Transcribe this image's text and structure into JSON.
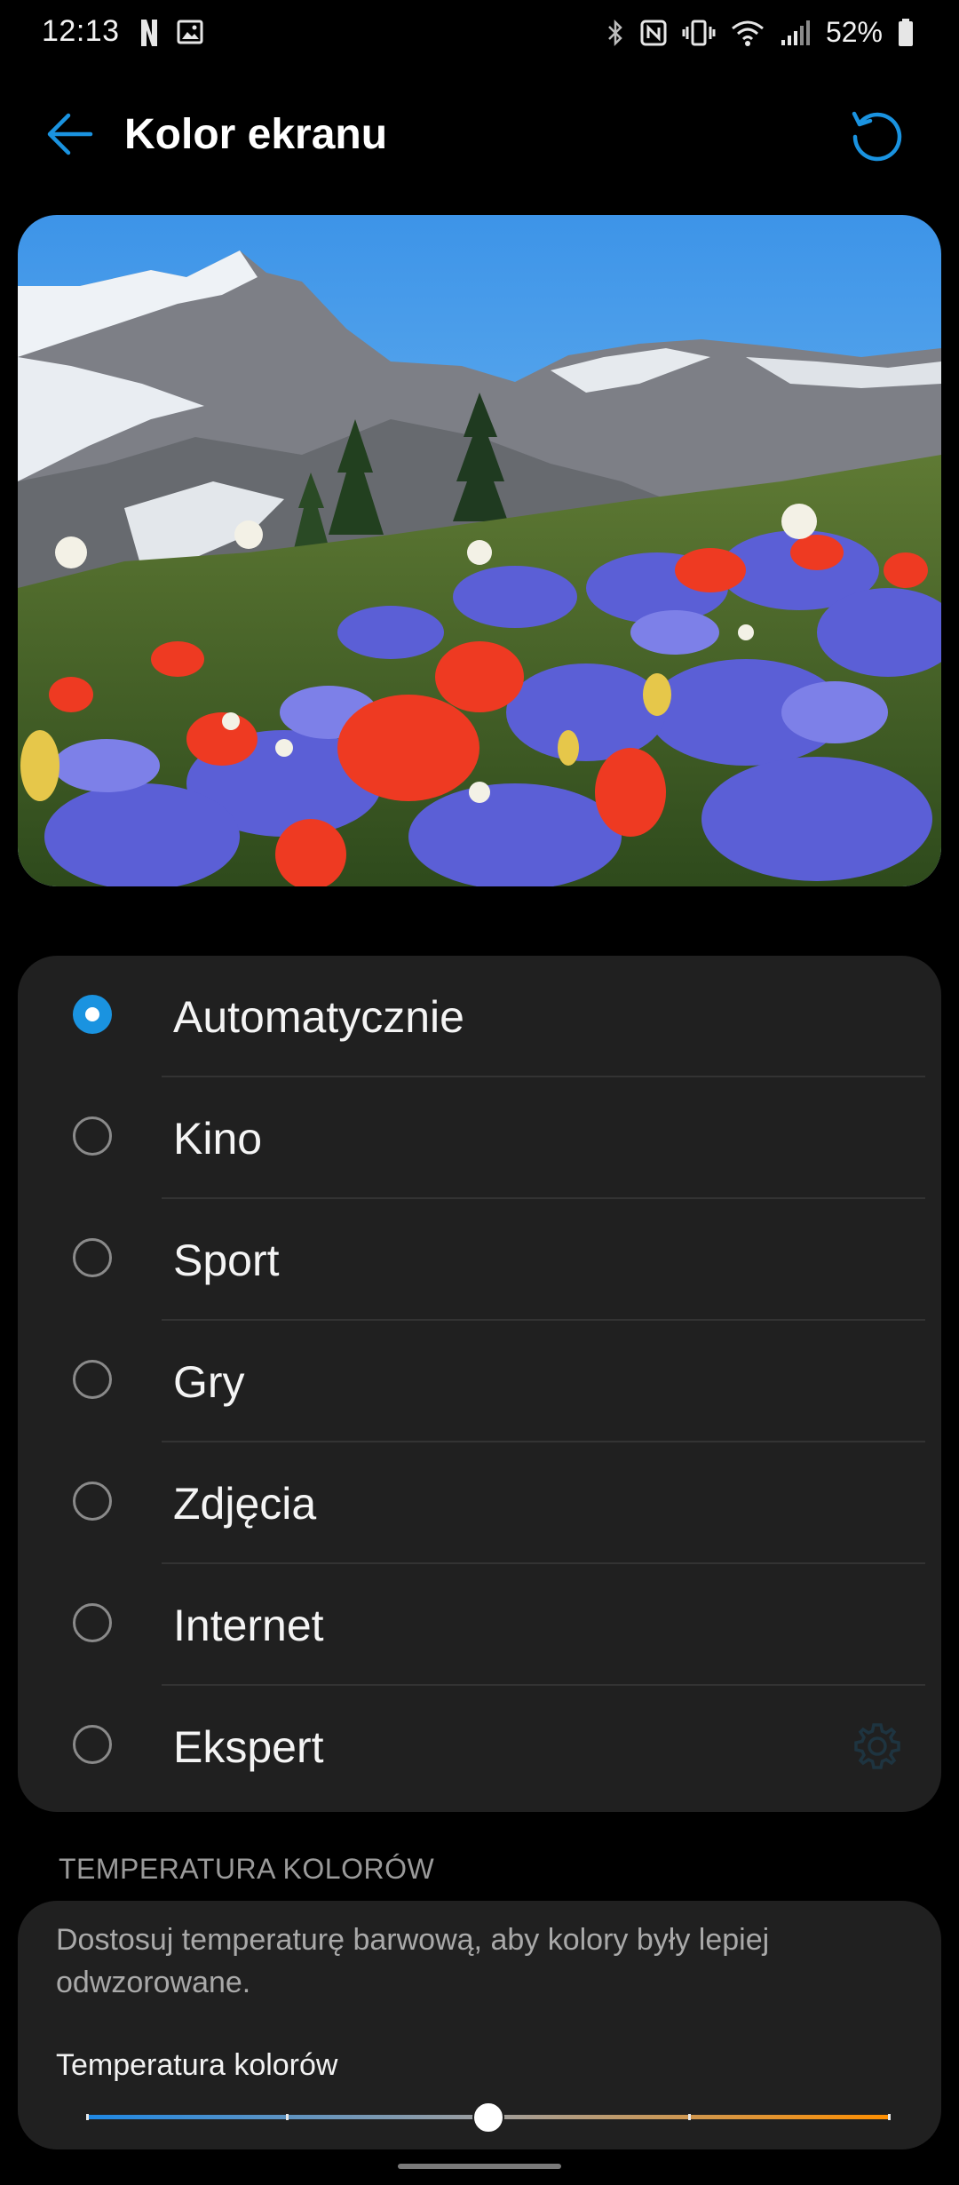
{
  "status_bar": {
    "time": "12:13",
    "left_icons": [
      "netflix-icon",
      "image-icon"
    ],
    "right_icons": [
      "bluetooth-icon",
      "nfc-icon",
      "vibrate-icon",
      "wifi-icon",
      "signal-icon",
      "battery-icon"
    ],
    "battery_percent": "52%"
  },
  "app_bar": {
    "title": "Kolor ekranu",
    "back_icon": "arrow-left-icon",
    "reset_icon": "refresh-icon",
    "accent_color": "#1a93e0"
  },
  "preview": {
    "subject": "mountain-wildflower-landscape"
  },
  "color_modes": {
    "selected": "Automatycznie",
    "options": [
      {
        "label": "Automatycznie",
        "selected": true
      },
      {
        "label": "Kino",
        "selected": false
      },
      {
        "label": "Sport",
        "selected": false
      },
      {
        "label": "Gry",
        "selected": false
      },
      {
        "label": "Zdjęcia",
        "selected": false
      },
      {
        "label": "Internet",
        "selected": false
      },
      {
        "label": "Ekspert",
        "selected": false,
        "settings_icon": "gear-icon",
        "settings_enabled": false
      }
    ]
  },
  "temperature": {
    "section_header": "TEMPERATURA KOLORÓW",
    "description": "Dostosuj temperaturę barwową, aby kolory były lepiej odwzorowane.",
    "slider_label": "Temperatura kolorów",
    "slider_value": 0.5,
    "slider_ticks": 5,
    "gradient_colors": [
      "#1e88e5",
      "#9e9e9e",
      "#ff8f00"
    ]
  }
}
